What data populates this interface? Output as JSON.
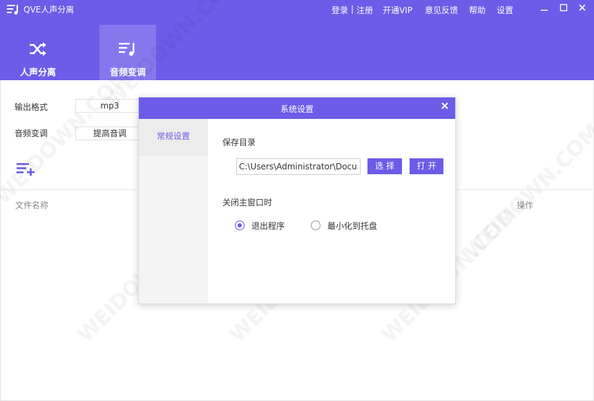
{
  "app": {
    "title": "QVE人声分离",
    "logo_icon": "menu-music-icon"
  },
  "top_links": {
    "login": "登录",
    "separator": "|",
    "register": "注册",
    "vip": "开通VIP",
    "feedback": "意见反馈",
    "help": "帮助",
    "settings": "设置"
  },
  "window_controls": [
    "minimize-icon",
    "maximize-icon",
    "close-icon"
  ],
  "tabs": [
    {
      "label": "人声分离",
      "icon": "shuffle-icon",
      "active": false
    },
    {
      "label": "音频变调",
      "icon": "music-list-icon",
      "active": true
    }
  ],
  "form": {
    "format_label": "输出格式",
    "format_value": "mp3",
    "pitch_label": "音频变调",
    "pitch_value": "提高音调"
  },
  "list": {
    "col_name": "文件名称",
    "col_action": "操作"
  },
  "watermark": "WEIDOWN.COM",
  "dialog": {
    "title": "系统设置",
    "nav": [
      "常规设置"
    ],
    "save_dir_label": "保存目录",
    "save_dir_value": "C:\\Users\\Administrator\\Documents",
    "choose_button": "选择",
    "open_button": "打开",
    "on_close_label": "关闭主窗口时",
    "options": [
      {
        "label": "退出程序",
        "checked": true
      },
      {
        "label": "最小化到托盘",
        "checked": false
      }
    ]
  },
  "colors": {
    "accent": "#6c5ce7",
    "accent_light": "#8677ee"
  }
}
